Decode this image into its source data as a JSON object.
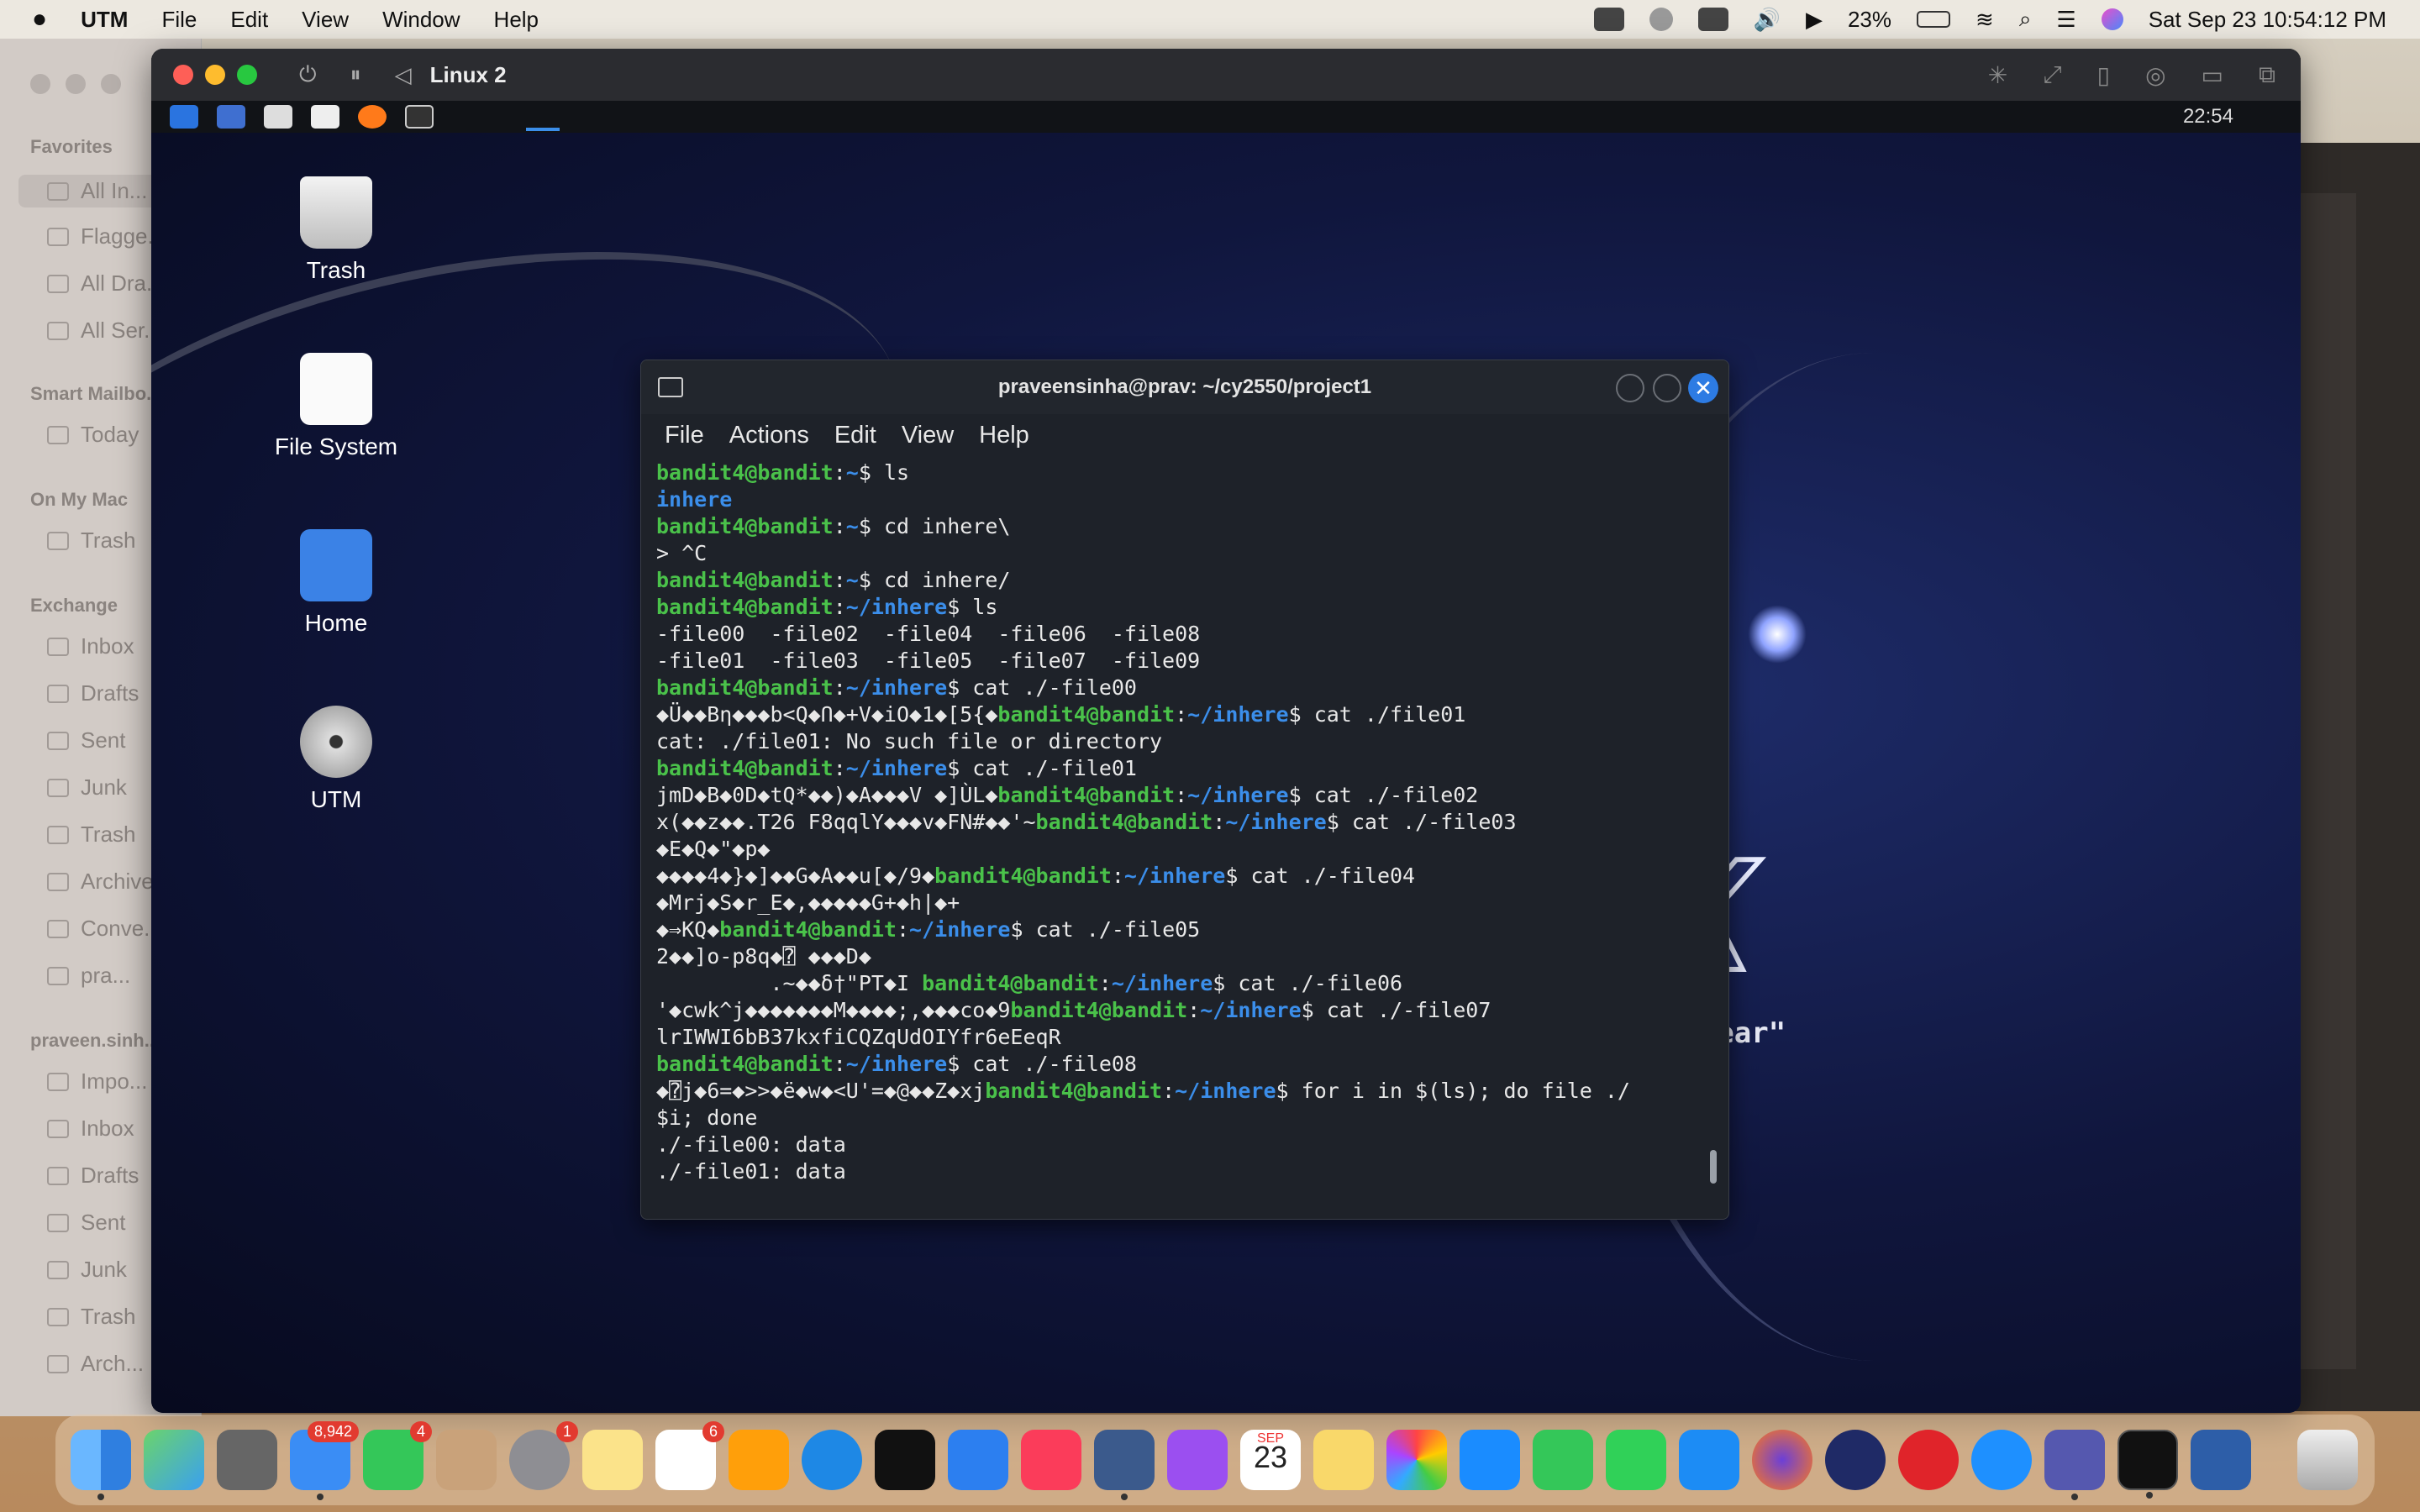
{
  "macmenu": {
    "apple": "",
    "app": "UTM",
    "items": [
      "File",
      "Edit",
      "View",
      "Window",
      "Help"
    ],
    "battery": "23%",
    "datetime": "Sat Sep 23  10:54:12 PM"
  },
  "mail": {
    "sections": [
      {
        "label": "Favorites",
        "items": [
          "All In...",
          "Flagge...",
          "All Dra...",
          "All Ser..."
        ]
      },
      {
        "label": "Smart Mailbo...",
        "items": [
          "Today"
        ]
      },
      {
        "label": "On My Mac",
        "items": [
          "Trash"
        ]
      },
      {
        "label": "Exchange",
        "items": [
          "Inbox",
          "Drafts",
          "Sent",
          "Junk",
          "Trash",
          "Archive",
          "Conve...",
          "pra..."
        ]
      },
      {
        "label": "praveen.sinh...",
        "items": [
          "Impo...",
          "Inbox",
          "Drafts",
          "Sent",
          "Junk",
          "Trash",
          "Arch..."
        ]
      }
    ]
  },
  "utm": {
    "title": "Linux 2"
  },
  "kali": {
    "clock": "22:54",
    "desktop_icons": [
      "Trash",
      "File System",
      "Home",
      "UTM"
    ],
    "logo": "UX",
    "quote": "le to hear\""
  },
  "terminal": {
    "title": "praveensinha@prav: ~/cy2550/project1",
    "menu": [
      "File",
      "Actions",
      "Edit",
      "View",
      "Help"
    ],
    "lines": [
      [
        [
          "u",
          "bandit4@bandit"
        ],
        [
          "t",
          ":"
        ],
        [
          "d",
          "~"
        ],
        [
          "t",
          "$ ls"
        ]
      ],
      [
        [
          "d",
          "inhere"
        ]
      ],
      [
        [
          "u",
          "bandit4@bandit"
        ],
        [
          "t",
          ":"
        ],
        [
          "d",
          "~"
        ],
        [
          "t",
          "$ cd inhere\\"
        ]
      ],
      [
        [
          "t",
          "> ^C"
        ]
      ],
      [
        [
          "u",
          "bandit4@bandit"
        ],
        [
          "t",
          ":"
        ],
        [
          "d",
          "~"
        ],
        [
          "t",
          "$ cd inhere/"
        ]
      ],
      [
        [
          "u",
          "bandit4@bandit"
        ],
        [
          "t",
          ":"
        ],
        [
          "d",
          "~/inhere"
        ],
        [
          "t",
          "$ ls"
        ]
      ],
      [
        [
          "t",
          "-file00  -file02  -file04  -file06  -file08"
        ]
      ],
      [
        [
          "t",
          "-file01  -file03  -file05  -file07  -file09"
        ]
      ],
      [
        [
          "u",
          "bandit4@bandit"
        ],
        [
          "t",
          ":"
        ],
        [
          "d",
          "~/inhere"
        ],
        [
          "t",
          "$ cat ./-file00"
        ]
      ],
      [
        [
          "t",
          "◆Ü◆◆Bη◆◆◆b<Q◆Ո◆+V◆iO◆1◆[5{◆"
        ],
        [
          "u",
          "bandit4@bandit"
        ],
        [
          "t",
          ":"
        ],
        [
          "d",
          "~/inhere"
        ],
        [
          "t",
          "$ cat ./file01"
        ]
      ],
      [
        [
          "t",
          "cat: ./file01: No such file or directory"
        ]
      ],
      [
        [
          "u",
          "bandit4@bandit"
        ],
        [
          "t",
          ":"
        ],
        [
          "d",
          "~/inhere"
        ],
        [
          "t",
          "$ cat ./-file01"
        ]
      ],
      [
        [
          "t",
          "jmD◆B◆0D◆tQ*◆◆)◆A◆◆◆V ◆]ÙL◆"
        ],
        [
          "u",
          "bandit4@bandit"
        ],
        [
          "t",
          ":"
        ],
        [
          "d",
          "~/inhere"
        ],
        [
          "t",
          "$ cat ./-file02"
        ]
      ],
      [
        [
          "t",
          "x(◆◆z◆◆.T26 F8qqlY◆◆◆v◆FN#◆◆'~"
        ],
        [
          "u",
          "bandit4@bandit"
        ],
        [
          "t",
          ":"
        ],
        [
          "d",
          "~/inhere"
        ],
        [
          "t",
          "$ cat ./-file03"
        ]
      ],
      [
        [
          "t",
          "◆E◆Q◆\"◆p◆"
        ]
      ],
      [
        [
          "t",
          "◆◆◆◆4◆}◆]◆◆G◆A◆◆u[◆/9◆"
        ],
        [
          "u",
          "bandit4@bandit"
        ],
        [
          "t",
          ":"
        ],
        [
          "d",
          "~/inhere"
        ],
        [
          "t",
          "$ cat ./-file04"
        ]
      ],
      [
        [
          "t",
          "◆Mrj◆S◆r_E◆,◆◆◆◆◆G+◆h|◆+"
        ]
      ],
      [
        [
          "t",
          "◆⇒KQ◆"
        ],
        [
          "u",
          "bandit4@bandit"
        ],
        [
          "t",
          ":"
        ],
        [
          "d",
          "~/inhere"
        ],
        [
          "t",
          "$ cat ./-file05"
        ]
      ],
      [
        [
          "t",
          "2◆◆]o-p8q◆⍰ ◆◆◆D◆"
        ]
      ],
      [
        [
          "t",
          "         .~◆◆δ†\"PT◆I "
        ],
        [
          "u",
          "bandit4@bandit"
        ],
        [
          "t",
          ":"
        ],
        [
          "d",
          "~/inhere"
        ],
        [
          "t",
          "$ cat ./-file06"
        ]
      ],
      [
        [
          "t",
          "'◆cwk^j◆◆◆◆◆◆◆M◆◆◆◆;,◆◆◆co◆9"
        ],
        [
          "u",
          "bandit4@bandit"
        ],
        [
          "t",
          ":"
        ],
        [
          "d",
          "~/inhere"
        ],
        [
          "t",
          "$ cat ./-file07"
        ]
      ],
      [
        [
          "t",
          "lrIWWI6bB37kxfiCQZqUdOIYfr6eEeqR"
        ]
      ],
      [
        [
          "u",
          "bandit4@bandit"
        ],
        [
          "t",
          ":"
        ],
        [
          "d",
          "~/inhere"
        ],
        [
          "t",
          "$ cat ./-file08"
        ]
      ],
      [
        [
          "t",
          "◆⍰j◆6=◆>>◆ë◆w◆<U'=◆@◆◆Z◆xj"
        ],
        [
          "u",
          "bandit4@bandit"
        ],
        [
          "t",
          ":"
        ],
        [
          "d",
          "~/inhere"
        ],
        [
          "t",
          "$ for i in $(ls); do file ./"
        ]
      ],
      [
        [
          "t",
          "$i; done"
        ]
      ],
      [
        [
          "t",
          "./-file00: data"
        ]
      ],
      [
        [
          "t",
          "./-file01: data"
        ]
      ]
    ]
  },
  "dock": {
    "badges": {
      "mail": "8,942",
      "messages": "4",
      "settings": "1",
      "reminders": "6"
    },
    "calendar_month": "SEP",
    "calendar_day": "23"
  }
}
